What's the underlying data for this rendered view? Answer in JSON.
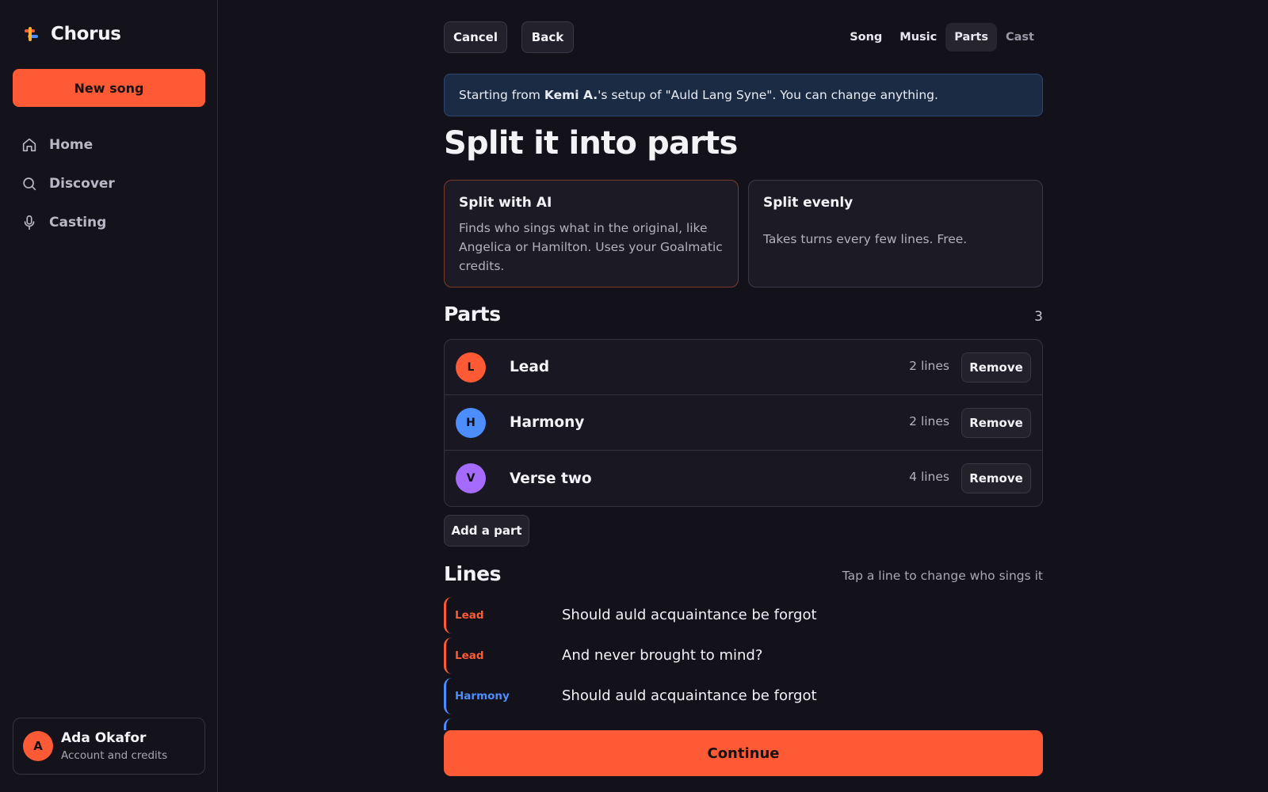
{
  "app": {
    "name": "Chorus",
    "accent": "#ff5a36"
  },
  "sidebar": {
    "new_song_label": "New song",
    "items": [
      {
        "label": "Home",
        "icon": "home-icon"
      },
      {
        "label": "Discover",
        "icon": "search-icon"
      },
      {
        "label": "Casting",
        "icon": "microphone-icon"
      }
    ],
    "account": {
      "initial": "A",
      "name": "Ada Okafor",
      "subtitle": "Account and credits"
    }
  },
  "toolbar": {
    "cancel_label": "Cancel",
    "back_label": "Back",
    "steps": [
      {
        "label": "Song",
        "state": "done"
      },
      {
        "label": "Music",
        "state": "done"
      },
      {
        "label": "Parts",
        "state": "active"
      },
      {
        "label": "Cast",
        "state": "upcoming"
      }
    ]
  },
  "banner": {
    "prefix": "Starting from",
    "author": "Kemi A.",
    "suffix": "'s setup of \"Auld Lang Syne\". You can change anything."
  },
  "page_title": "Split it into parts",
  "split_options": {
    "ai": {
      "title": "Split with AI",
      "description": "Finds who sings what in the original, like Angelica or Hamilton. Uses your Goalmatic credits."
    },
    "even": {
      "title": "Split evenly",
      "description": "Takes turns every few lines. Free."
    }
  },
  "parts": {
    "title": "Parts",
    "count": "3",
    "remove_label": "Remove",
    "add_label": "Add a part",
    "items": [
      {
        "initial": "L",
        "name": "Lead",
        "lines": "2 lines",
        "color": "#ff5a36"
      },
      {
        "initial": "H",
        "name": "Harmony",
        "lines": "2 lines",
        "color": "#4c8dff"
      },
      {
        "initial": "V",
        "name": "Verse two",
        "lines": "4 lines",
        "color": "#a56bff"
      }
    ]
  },
  "lines": {
    "title": "Lines",
    "hint": "Tap a line to change who sings it",
    "items": [
      {
        "part": "Lead",
        "text": "Should auld acquaintance be forgot",
        "color": "#ff5a36"
      },
      {
        "part": "Lead",
        "text": "And never brought to mind?",
        "color": "#ff5a36"
      },
      {
        "part": "Harmony",
        "text": "Should auld acquaintance be forgot",
        "color": "#4c8dff"
      }
    ]
  },
  "continue_label": "Continue"
}
